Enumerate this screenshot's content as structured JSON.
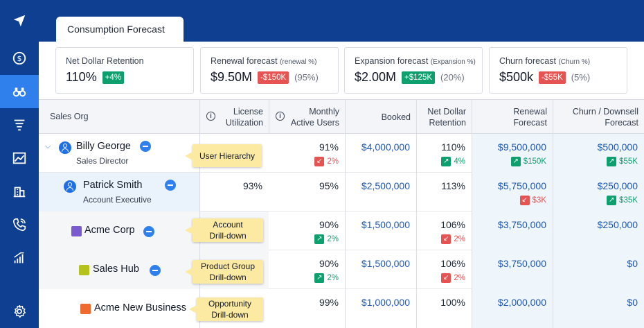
{
  "sidebar": {
    "icons": [
      "send-icon",
      "dollar-icon",
      "binoculars-icon",
      "funnel-icon",
      "chart-image-icon",
      "building-icon",
      "phone-icon",
      "bar-chart-icon",
      "gear-icon"
    ],
    "active": "binoculars-icon"
  },
  "tab": {
    "label": "Consumption Forecast"
  },
  "kpis": {
    "ndr": {
      "title": "Net Dollar Retention",
      "value": "110%",
      "badge": "+4%"
    },
    "renewal": {
      "title": "Renewal forecast",
      "sub": "(renewal %)",
      "value": "$9.50M",
      "badge": "-$150K",
      "pct": "(95%)"
    },
    "expansion": {
      "title": "Expansion forecast",
      "sub": "(Expansion %)",
      "value": "$2.00M",
      "badge": "+$125K",
      "pct": "(20%)"
    },
    "churn": {
      "title": "Churn forecast",
      "sub": "(Churn %)",
      "value": "$500k",
      "badge": "-$55K",
      "pct": "(5%)"
    }
  },
  "table": {
    "headers": {
      "org": "Sales Org",
      "license1": "License",
      "license2": "Utilization",
      "mau1": "Monthly",
      "mau2": "Active Users",
      "booked": "Booked",
      "ndr1": "Net Dollar",
      "ndr2": "Retention",
      "renewal1": "Renewal",
      "renewal2": "Forecast",
      "churn1": "Churn / Downsell",
      "churn2": "Forecast"
    },
    "rows": [
      {
        "name": "Billy George",
        "role": "Sales Director",
        "license": "",
        "mau": "91%",
        "mau_delta": "2%",
        "booked": "$4,000,000",
        "ndr": "110%",
        "ndr_delta": "4%",
        "renewal": "$9,500,000",
        "renewal_delta": "$150K",
        "churn": "$500,000",
        "churn_delta": "$55K"
      },
      {
        "name": "Patrick Smith",
        "role": "Account Executive",
        "license": "93%",
        "mau": "95%",
        "booked": "$2,500,000",
        "ndr": "113%",
        "renewal": "$5,750,000",
        "renewal_delta": "$3K",
        "churn": "$250,000",
        "churn_delta": "$35K"
      },
      {
        "name": "Acme Corp",
        "mau": "90%",
        "mau_delta": "2%",
        "booked": "$1,500,000",
        "ndr": "106%",
        "ndr_delta": "2%",
        "renewal": "$3,750,000",
        "churn": "$250,000"
      },
      {
        "name": "Sales Hub",
        "mau": "90%",
        "mau_delta": "2%",
        "booked": "$1,500,000",
        "ndr": "106%",
        "ndr_delta": "2%",
        "renewal": "$3,750,000",
        "churn": "$0"
      },
      {
        "name": "Acme New Business",
        "mau": "99%",
        "booked": "$1,000,000",
        "ndr": "100%",
        "renewal": "$2,000,000",
        "churn": "$0"
      }
    ]
  },
  "callouts": {
    "user": "User Hierarchy",
    "account1": "Account",
    "account2": "Drill-down",
    "product1": "Product Group",
    "product2": "Drill-down",
    "opp1": "Opportunity",
    "opp2": "Drill-down"
  },
  "colors": {
    "brand": "#0f3f91",
    "accent": "#2f80ed",
    "positive": "#0e9f6e",
    "negative": "#e55353",
    "callout": "#fdeaa2"
  }
}
